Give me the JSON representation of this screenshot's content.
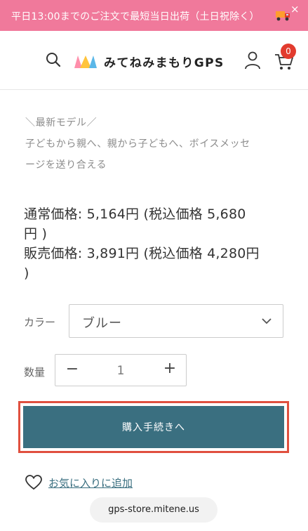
{
  "banner": {
    "text": "平日13:00までのご注文で最短当日出荷（土日祝除く）",
    "close": "×"
  },
  "header": {
    "logo_text": "みてねみまもりGPS",
    "cart_count": "0"
  },
  "product": {
    "tagline_1": "＼最新モデル／",
    "tagline_2": "子どもから親へ、親から子どもへ、ボイスメッセ",
    "tagline_3": "ージを送り合える",
    "regular_price_1": "通常価格: 5,164円 (税込価格 5,680",
    "regular_price_2": "円 )",
    "sale_price_1": "販売価格: 3,891円 (税込価格 4,280円",
    "sale_price_2": ")"
  },
  "color": {
    "label": "カラー",
    "selected": "ブルー"
  },
  "quantity": {
    "label": "数量",
    "value": "1",
    "minus": "−",
    "plus": "+"
  },
  "buy_button": "購入手続きへ",
  "wishlist": "お気に入りに追加",
  "url": "gps-store.mitene.us",
  "colors": {
    "banner": "#f0799b",
    "button": "#3a6f80",
    "highlight": "#e0503f",
    "badge": "#e23b2e"
  }
}
